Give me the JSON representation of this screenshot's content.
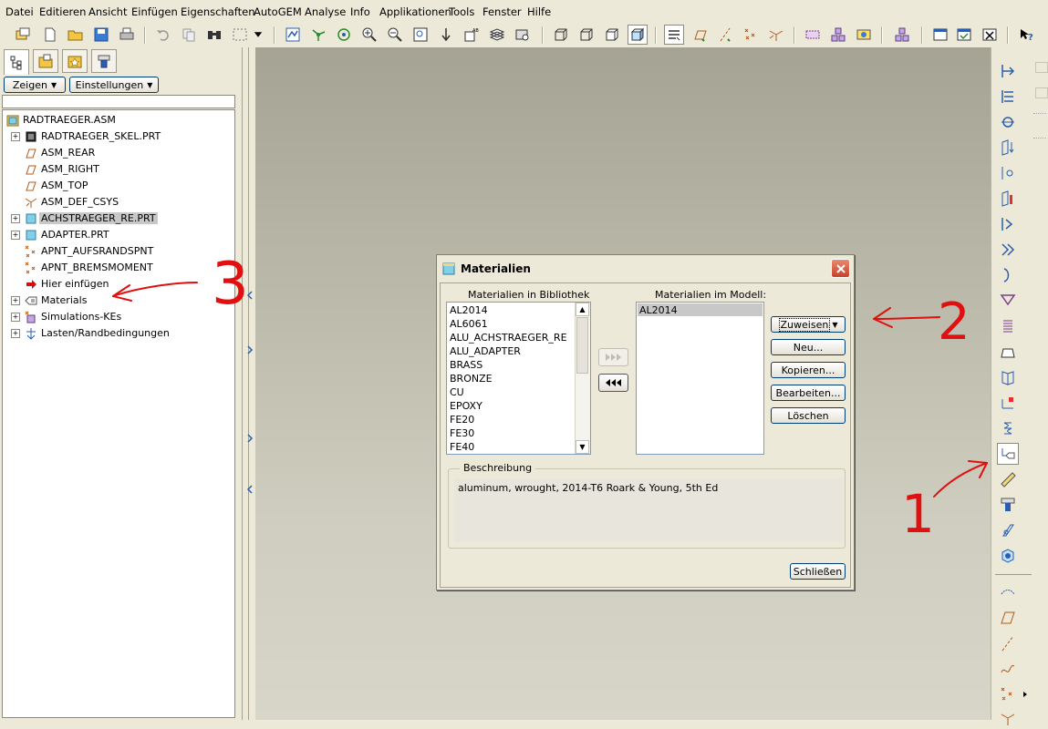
{
  "menu": [
    "Datei",
    "Editieren",
    "Ansicht",
    "Einfügen",
    "Eigenschaften",
    "AutoGEM",
    "Analyse",
    "Info",
    "Applikationen",
    "Tools",
    "Fenster",
    "Hilfe"
  ],
  "left_panel": {
    "show_button": "Zeigen",
    "settings_button": "Einstellungen"
  },
  "tree": {
    "root": "RADTRAEGER.ASM",
    "items": [
      {
        "label": "RADTRAEGER_SKEL.PRT"
      },
      {
        "label": "ASM_REAR"
      },
      {
        "label": "ASM_RIGHT"
      },
      {
        "label": "ASM_TOP"
      },
      {
        "label": "ASM_DEF_CSYS"
      },
      {
        "label": "ACHSTRAEGER_RE.PRT"
      },
      {
        "label": "ADAPTER.PRT"
      },
      {
        "label": "APNT_AUFSRANDSPNT"
      },
      {
        "label": "APNT_BREMSMOMENT"
      },
      {
        "label": "Hier einfügen"
      },
      {
        "label": "Materials"
      },
      {
        "label": "Simulations-KEs"
      },
      {
        "label": "Lasten/Randbedingungen"
      }
    ]
  },
  "dialog": {
    "title": "Materialien",
    "library_label": "Materialien in Bibliothek",
    "library_items": [
      "AL2014",
      "AL6061",
      "ALU_ACHSTRAEGER_RE",
      "ALU_ADAPTER",
      "BRASS",
      "BRONZE",
      "CU",
      "EPOXY",
      "FE20",
      "FE30",
      "FE40"
    ],
    "model_label": "Materialien im Modell:",
    "model_items": [
      "AL2014"
    ],
    "buttons": {
      "assign": "Zuweisen",
      "new": "Neu...",
      "copy": "Kopieren...",
      "edit": "Bearbeiten...",
      "delete": "Löschen",
      "close": "Schließen"
    },
    "description_label": "Beschreibung",
    "description_text": "aluminum, wrought, 2014-T6    Roark & Young, 5th Ed"
  },
  "annotations": {
    "one": "1",
    "two": "2",
    "three": "3",
    "color": "#e01010"
  }
}
